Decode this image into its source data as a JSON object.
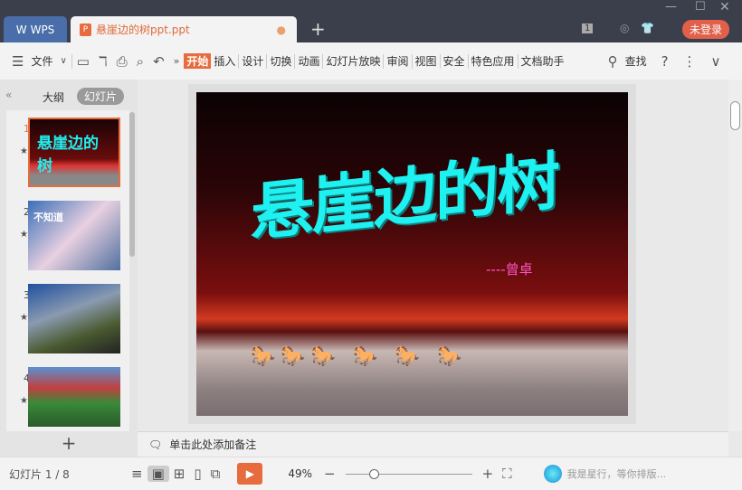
{
  "app": {
    "wps_label": "WPS",
    "doc_tab": "悬崖边的树ppt.ppt",
    "login": "未登录",
    "badge": "1"
  },
  "toolbar": {
    "file": "文件",
    "tabs": [
      "开始",
      "插入",
      "设计",
      "切换",
      "动画",
      "幻灯片放映",
      "审阅",
      "视图",
      "安全",
      "特色应用",
      "文档助手"
    ],
    "active_tab": "开始",
    "search": "查找",
    "help": "?"
  },
  "sidebar": {
    "tab_outline": "大纲",
    "tab_slides": "幻灯片",
    "slides": [
      {
        "n": "1"
      },
      {
        "n": "2"
      },
      {
        "n": "3"
      },
      {
        "n": "4"
      }
    ]
  },
  "slide": {
    "title": "悬崖边的树",
    "author": "----曾卓"
  },
  "notes": {
    "placeholder": "单击此处添加备注"
  },
  "status": {
    "slide_counter": "幻灯片 1 / 8",
    "zoom": "49%",
    "zoom_value_percent": 49,
    "assistant": "我是星行，等你排版..."
  },
  "colors": {
    "accent": "#e66b3d",
    "titlebar": "#3b3f4b",
    "wps_tab": "#4a6ea9"
  }
}
